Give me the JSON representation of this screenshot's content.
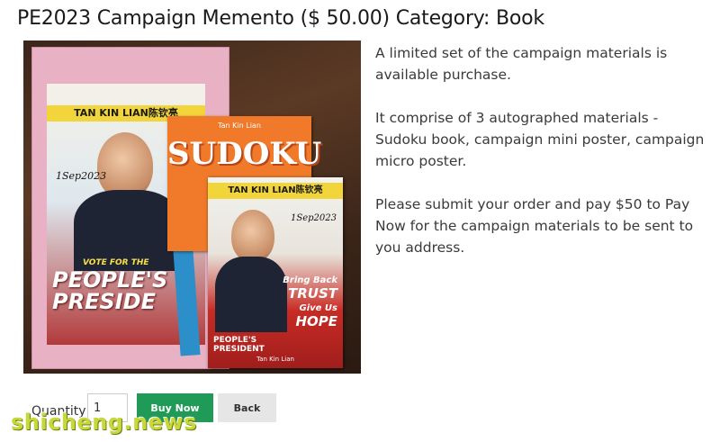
{
  "product": {
    "title": "PE2023 Campaign Memento ($ 50.00)  Category: Book",
    "image_text": {
      "envelope_header": "TAN KIN LIAN陈钦亮",
      "envelope_sign": "1Sep2023",
      "vote_line": "VOTE FOR THE",
      "big_slogan": "PEOPLE'S PRESIDE",
      "sudoku_author": "Tan Kin Lian",
      "sudoku_title": "SUDOKU",
      "small_header": "TAN KIN LIAN陈钦亮",
      "small_sign": "1Sep2023",
      "trust_line_1": "Bring Back",
      "trust_line_2": "TRUST",
      "trust_line_3": "Give Us",
      "trust_line_4": "HOPE",
      "small_slogan": "PEOPLE'S PRESIDENT",
      "small_footer": "Tan Kin Lian"
    },
    "description": [
      "A limited set of the campaign materials is available purchase.",
      "It comprise of 3 autographed materials - Sudoku book, campaign mini poster, campaign micro poster.",
      "Please submit your order and pay $50 to Pay Now for the campaign materials to be sent to you address."
    ]
  },
  "order": {
    "quantity_label": "Quantity",
    "quantity_value": "1",
    "buy_label": "Buy Now",
    "back_label": "Back"
  },
  "watermark": "shicheng.news"
}
